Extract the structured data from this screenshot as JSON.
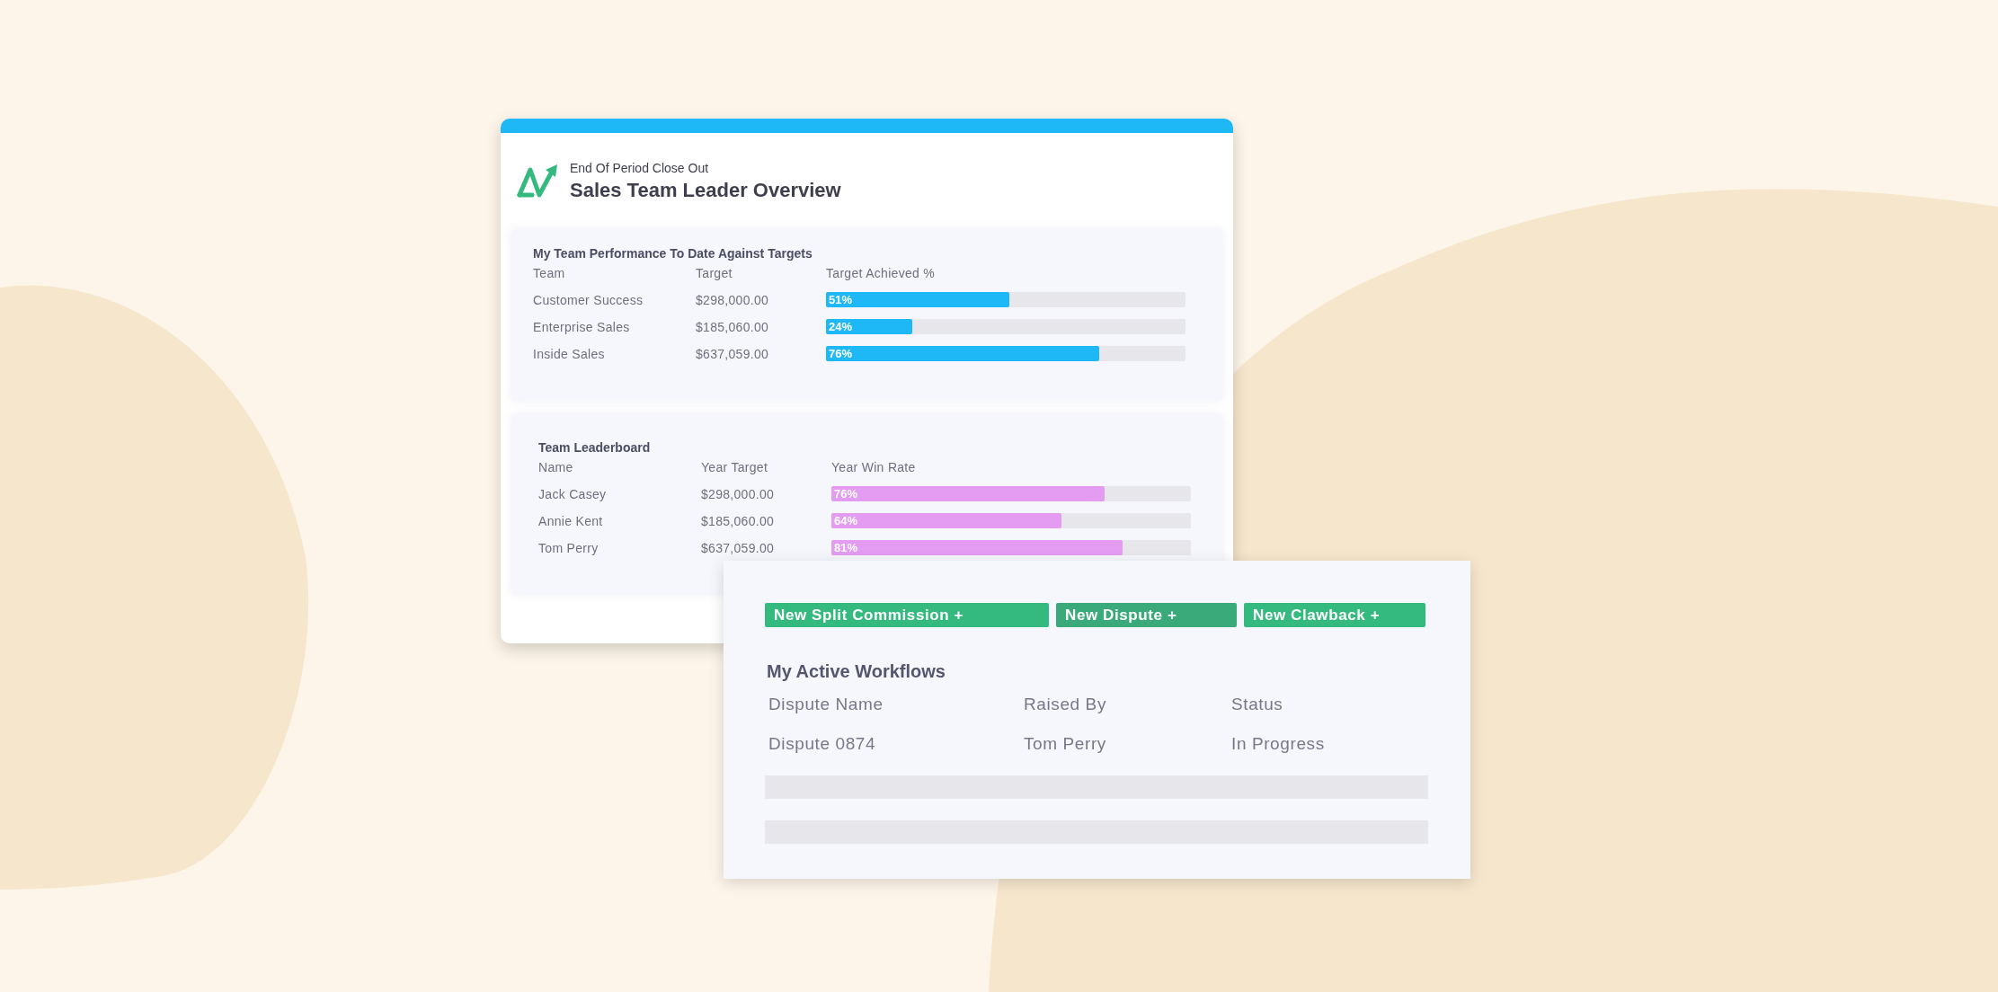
{
  "overview_card": {
    "subtitle": "End Of Period Close Out",
    "title": "Sales Team Leader Overview",
    "performance": {
      "title": "My Team Performance To Date Against Targets",
      "columns": [
        "Team",
        "Target",
        "Target Achieved %"
      ],
      "rows": [
        {
          "name": "Customer Success",
          "target": "$298,000.00",
          "percent": "51%",
          "level": 0.51
        },
        {
          "name": "Enterprise Sales",
          "target": "$185,060.00",
          "percent": "24%",
          "level": 0.24
        },
        {
          "name": "Inside Sales",
          "target": "$637,059.00",
          "percent": "76%",
          "level": 0.76
        }
      ]
    },
    "leaderboard": {
      "title": "Team Leaderboard",
      "columns": [
        "Name",
        "Year Target",
        "Year Win Rate"
      ],
      "rows": [
        {
          "name": "Jack Casey",
          "target": "$298,000.00",
          "percent": "76%",
          "level": 0.76
        },
        {
          "name": "Annie Kent",
          "target": "$185,060.00",
          "percent": "64%",
          "level": 0.64
        },
        {
          "name": "Tom Perry",
          "target": "$637,059.00",
          "percent": "81%",
          "level": 0.81
        }
      ]
    }
  },
  "workflow_card": {
    "buttons": [
      "New Split Commission +",
      "New Dispute +",
      "New Clawback +"
    ],
    "title": "My Active Workflows",
    "columns": [
      "Dispute Name",
      "Raised By",
      "Status"
    ],
    "rows": [
      {
        "kind": "entry",
        "cells": [
          "Dispute 0874",
          "Tom Perry",
          "In Progress"
        ]
      },
      {
        "kind": "blank"
      },
      {
        "kind": "blank"
      }
    ]
  }
}
